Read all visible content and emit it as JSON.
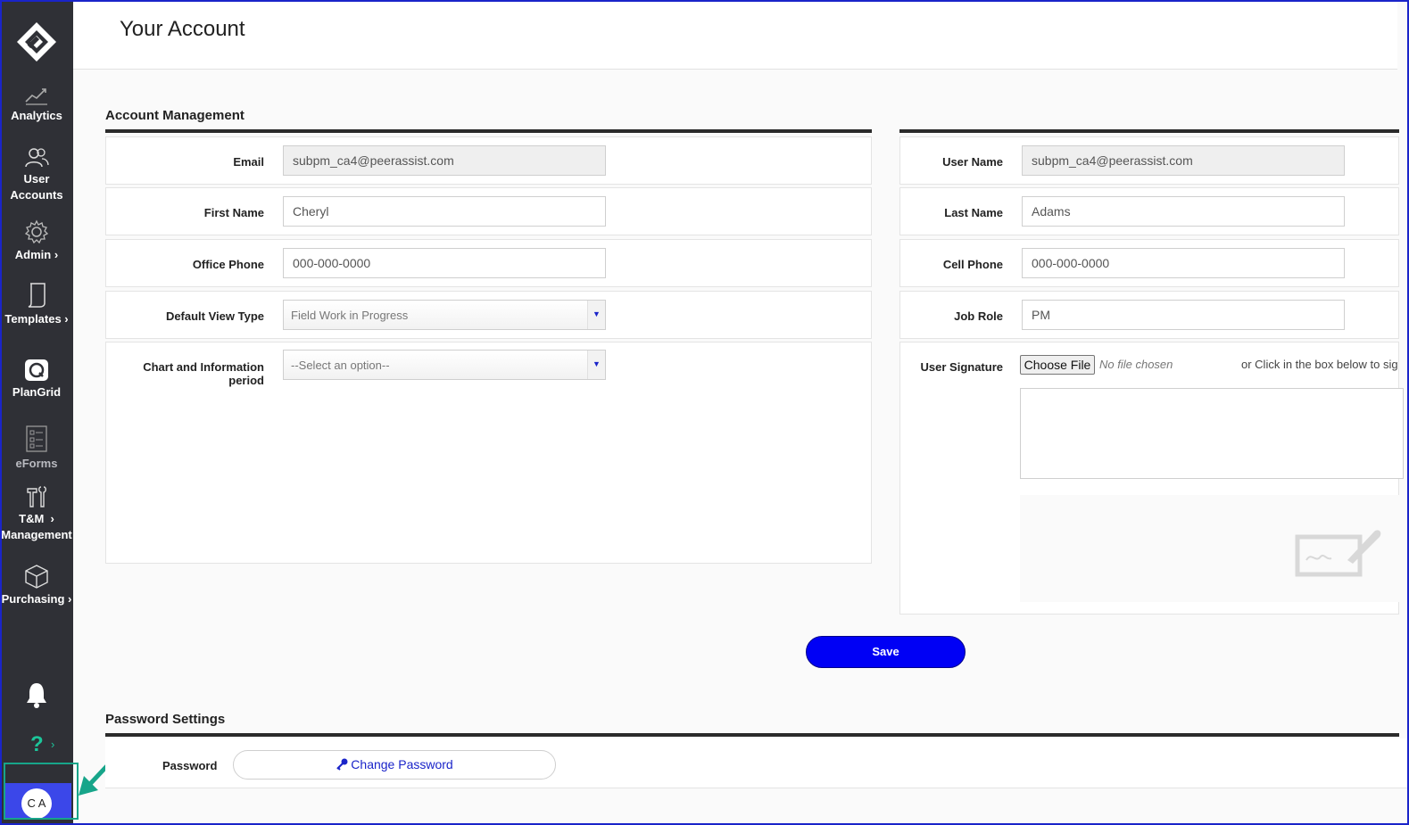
{
  "header": {
    "title": "Your Account"
  },
  "sidebar": {
    "items": [
      {
        "label": "Analytics",
        "icon": "analytics-icon"
      },
      {
        "label": "User Accounts",
        "line1": "User",
        "line2": "Accounts",
        "icon": "users-icon"
      },
      {
        "label": "Admin ›",
        "icon": "gear-icon"
      },
      {
        "label": "Templates ›",
        "icon": "template-icon"
      },
      {
        "label": "PlanGrid",
        "icon": "plangrid-icon"
      },
      {
        "label": "eForms",
        "icon": "eforms-icon"
      },
      {
        "label": "T&M Management",
        "line1": "T&M  ›",
        "line2": "Management",
        "icon": "tools-icon"
      },
      {
        "label": "Purchasing ›",
        "icon": "box-icon"
      }
    ],
    "help": "?",
    "help_chevron": "›",
    "user_initials": "C A"
  },
  "account": {
    "section_title": "Account Management",
    "email_label": "Email",
    "email_value": "subpm_ca4@peerassist.com",
    "username_label": "User Name",
    "username_value": "subpm_ca4@peerassist.com",
    "first_name_label": "First Name",
    "first_name_value": "Cheryl",
    "last_name_label": "Last Name",
    "last_name_value": "Adams",
    "office_phone_label": "Office Phone",
    "office_phone_value": "000-000-0000",
    "cell_phone_label": "Cell Phone",
    "cell_phone_value": "000-000-0000",
    "default_view_label": "Default View Type",
    "default_view_value": "Field Work in Progress",
    "job_role_label": "Job Role",
    "job_role_value": "PM",
    "chart_period_label": "Chart and Information period",
    "chart_period_value": "--Select an option--",
    "signature_label": "User Signature",
    "choose_file": "Choose File",
    "no_file": "No file chosen",
    "or_click": "or Click in the box below to sig",
    "save": "Save"
  },
  "password": {
    "section_title": "Password Settings",
    "label": "Password",
    "button": "Change Password"
  },
  "colors": {
    "sidebar_bg": "#2f3036",
    "accent_blue": "#0000f5",
    "highlight_green": "#17a58a",
    "avatar_bg": "#3b47e9"
  }
}
